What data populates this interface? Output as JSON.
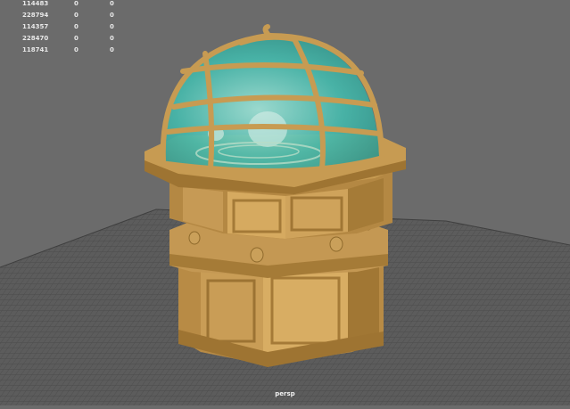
{
  "viewport": {
    "camera_label": "persp",
    "model": "octagonal wooden pedestal with glass dome and armillary rings",
    "colors": {
      "background": "#6b6b6b",
      "grid": "#4a4a4a",
      "wood": "#c79b52",
      "wood_dark": "#9a7431",
      "glass": "#3fb3a8"
    }
  },
  "hud": {
    "rows": [
      [
        "114483",
        "0",
        "0"
      ],
      [
        "228794",
        "0",
        "0"
      ],
      [
        "114357",
        "0",
        "0"
      ],
      [
        "228470",
        "0",
        "0"
      ],
      [
        "118741",
        "0",
        "0"
      ]
    ]
  }
}
